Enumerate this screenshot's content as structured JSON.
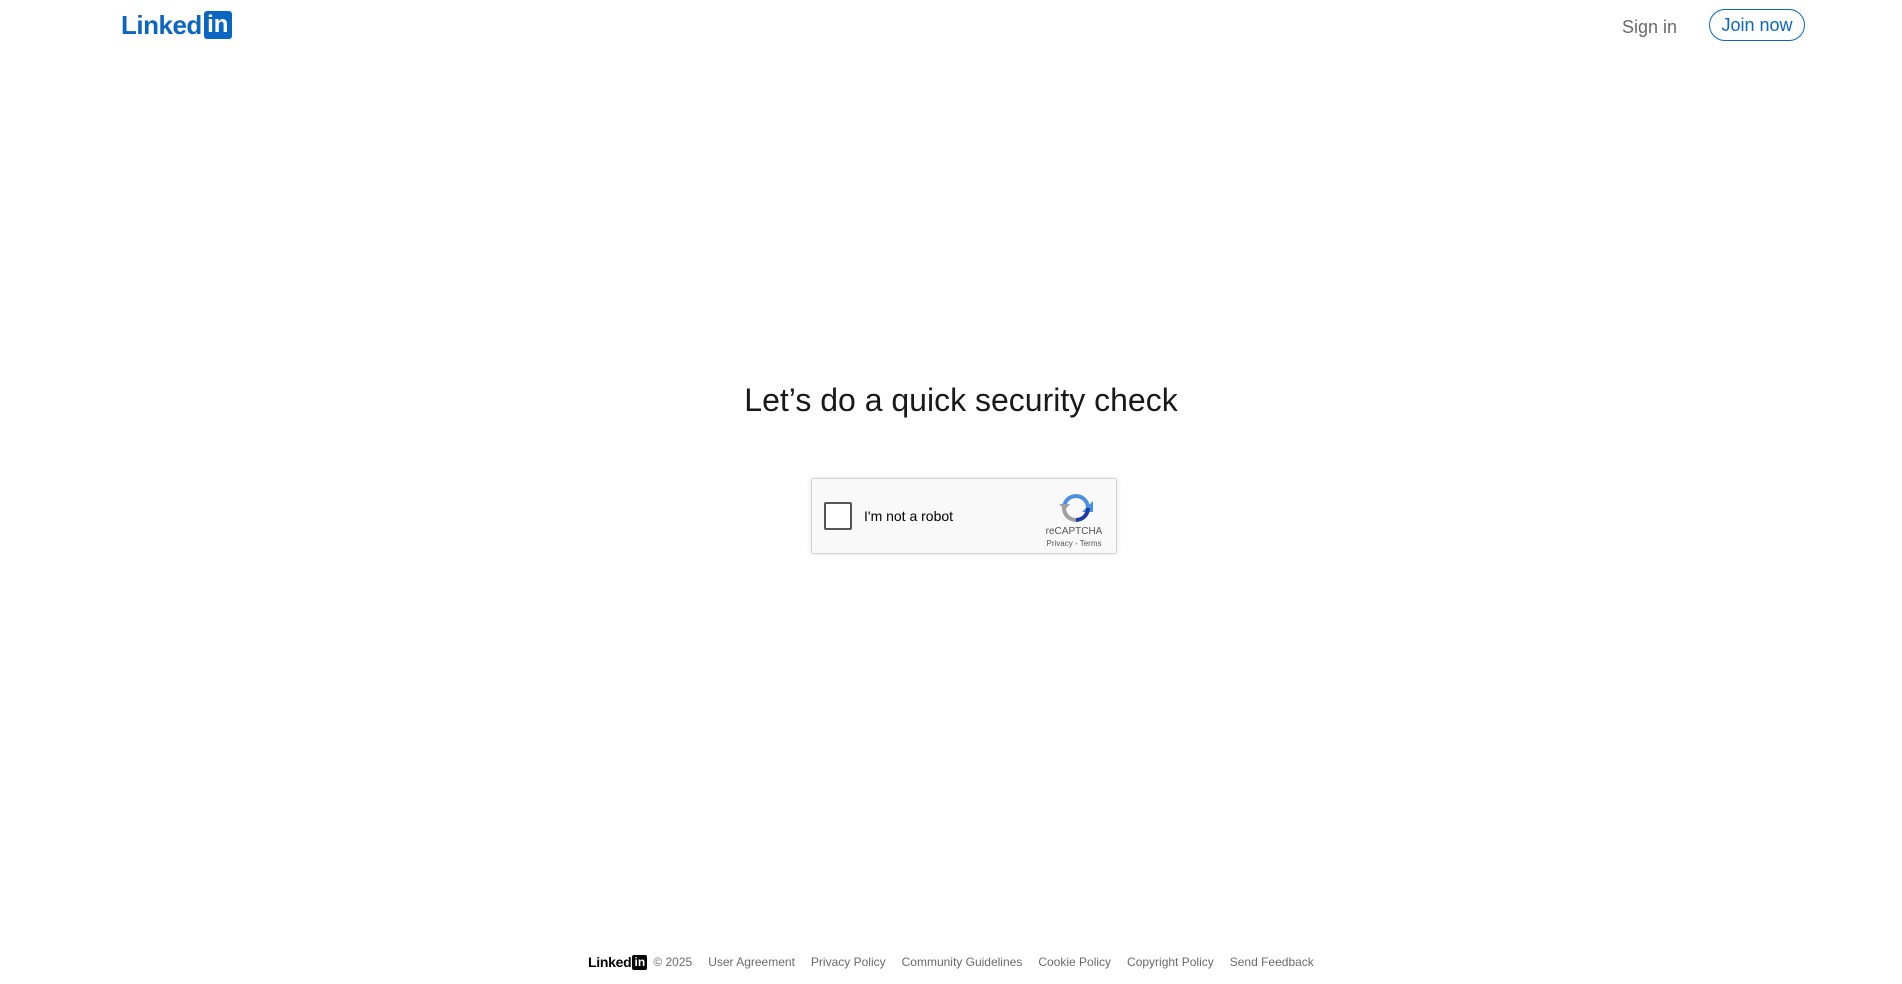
{
  "header": {
    "logo_word": "Linked",
    "logo_box": "in",
    "sign_in": "Sign in",
    "join_now": "Join now"
  },
  "main": {
    "title": "Let’s do a quick security check"
  },
  "recaptcha": {
    "label": "I'm not a robot",
    "brand": "reCAPTCHA",
    "privacy": "Privacy",
    "separator": " - ",
    "terms": "Terms"
  },
  "footer": {
    "logo_word": "Linked",
    "logo_box": "in",
    "copyright": "© 2025",
    "links": [
      "User Agreement",
      "Privacy Policy",
      "Community Guidelines",
      "Cookie Policy",
      "Copyright Policy",
      "Send Feedback"
    ]
  },
  "colors": {
    "brand": "#0a66c2",
    "text": "#000000e6",
    "muted": "#00000099"
  },
  "icons": {
    "recaptcha_logo": "recaptcha-logo-icon"
  }
}
